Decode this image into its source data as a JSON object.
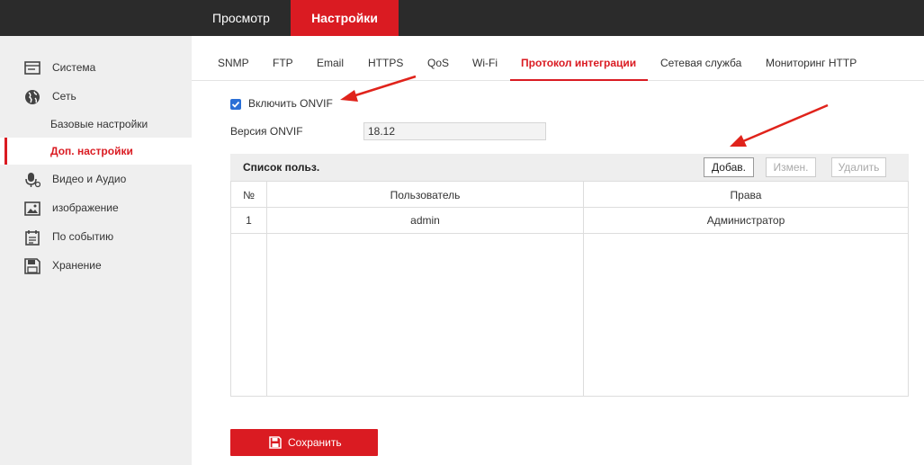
{
  "topnav": {
    "view": "Просмотр",
    "settings": "Настройки"
  },
  "sidebar": {
    "items": [
      {
        "label": "Система",
        "icon": "monitor-icon"
      },
      {
        "label": "Сеть",
        "icon": "globe-icon"
      },
      {
        "label": "Базовые настройки",
        "sub": true
      },
      {
        "label": "Доп. настройки",
        "sub": true,
        "active": true
      },
      {
        "label": "Видео и Аудио",
        "icon": "microphone-icon"
      },
      {
        "label": "изображение",
        "icon": "image-icon"
      },
      {
        "label": "По событию",
        "icon": "calendar-icon"
      },
      {
        "label": "Хранение",
        "icon": "floppy-icon"
      }
    ]
  },
  "tabs": [
    "SNMP",
    "FTP",
    "Email",
    "HTTPS",
    "QoS",
    "Wi-Fi",
    "Протокол интеграции",
    "Сетевая служба",
    "Мониторинг HTTP"
  ],
  "active_tab": "Протокол интеграции",
  "onvif": {
    "enable_label": "Включить ONVIF",
    "enabled": true,
    "version_label": "Версия ONVIF",
    "version_value": "18.12"
  },
  "user_list": {
    "title": "Список польз.",
    "add": "Добав.",
    "edit": "Измен.",
    "delete": "Удалить",
    "headers": {
      "num": "№",
      "user": "Пользователь",
      "rights": "Права"
    },
    "rows": [
      {
        "num": "1",
        "user": "admin",
        "rights": "Администратор"
      }
    ]
  },
  "save_label": "Сохранить",
  "colors": {
    "accent": "#da1b22",
    "topbar": "#2b2b2b",
    "sidebar": "#efefef"
  }
}
